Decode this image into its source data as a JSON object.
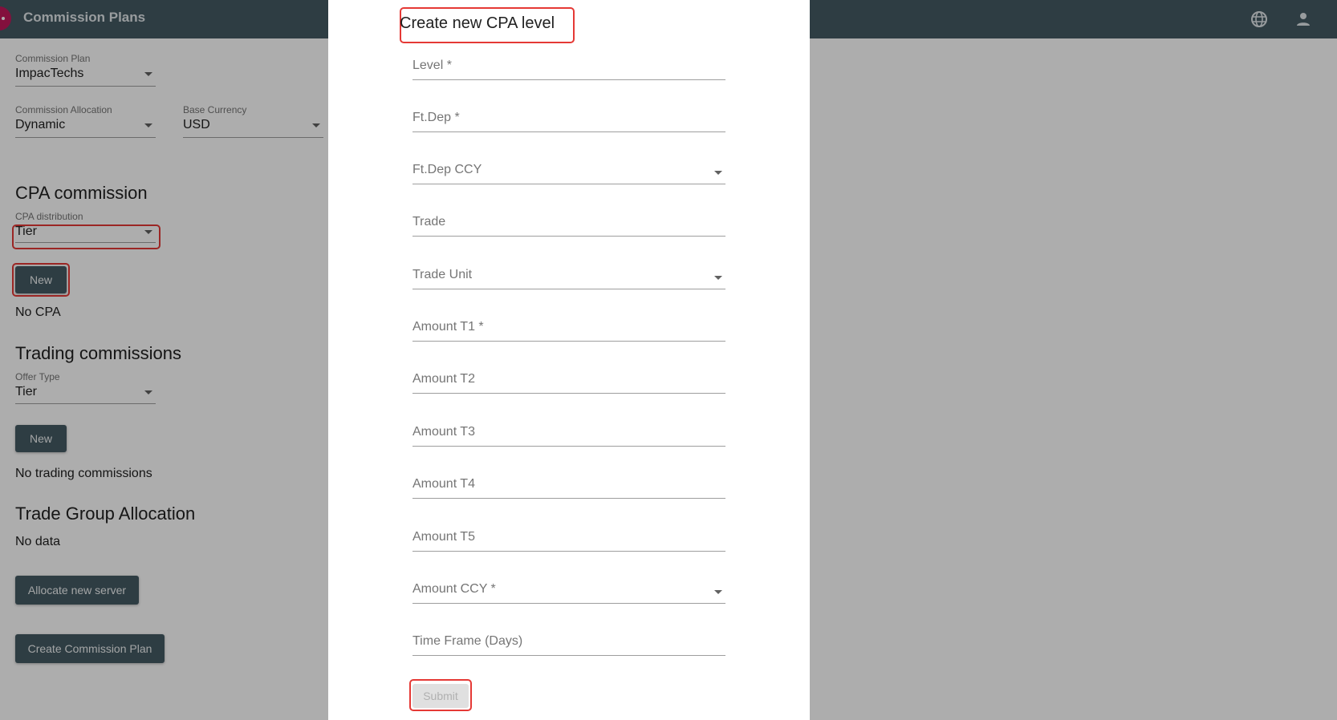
{
  "appbar": {
    "title": "Commission Plans",
    "icons": [
      "globe-icon",
      "user-icon"
    ],
    "background": "#455a64"
  },
  "form": {
    "commission_plan": {
      "label": "Commission Plan",
      "value": "ImpacTechs"
    },
    "commission_allocation": {
      "label": "Commission Allocation",
      "value": "Dynamic"
    },
    "base_currency": {
      "label": "Base Currency",
      "value": "USD"
    },
    "cpa": {
      "title": "CPA commission",
      "distribution": {
        "label": "CPA distribution",
        "value": "Tier"
      },
      "new_label": "New",
      "empty_text": "No CPA"
    },
    "trading": {
      "title": "Trading commissions",
      "offer_type": {
        "label": "Offer Type",
        "value": "Tier"
      },
      "new_label": "New",
      "empty_text": "No trading commissions"
    },
    "trade_group": {
      "title": "Trade Group Allocation",
      "empty_text": "No data",
      "allocate_label": "Allocate new server"
    },
    "create_label": "Create Commission Plan"
  },
  "dialog": {
    "title": "Create new CPA level",
    "fields": [
      {
        "placeholder": "Level *",
        "type": "input"
      },
      {
        "placeholder": "Ft.Dep *",
        "type": "input"
      },
      {
        "placeholder": "Ft.Dep CCY",
        "type": "select"
      },
      {
        "placeholder": "Trade",
        "type": "input"
      },
      {
        "placeholder": "Trade Unit",
        "type": "select"
      },
      {
        "placeholder": "Amount T1 *",
        "type": "input"
      },
      {
        "placeholder": "Amount T2",
        "type": "input"
      },
      {
        "placeholder": "Amount T3",
        "type": "input"
      },
      {
        "placeholder": "Amount T4",
        "type": "input"
      },
      {
        "placeholder": "Amount T5",
        "type": "input"
      },
      {
        "placeholder": "Amount CCY *",
        "type": "select"
      },
      {
        "placeholder": "Time Frame (Days)",
        "type": "input"
      }
    ],
    "submit_label": "Submit"
  },
  "colors": {
    "accent": "#455a64",
    "highlight": "#e53935",
    "logo": "#c2185b"
  }
}
